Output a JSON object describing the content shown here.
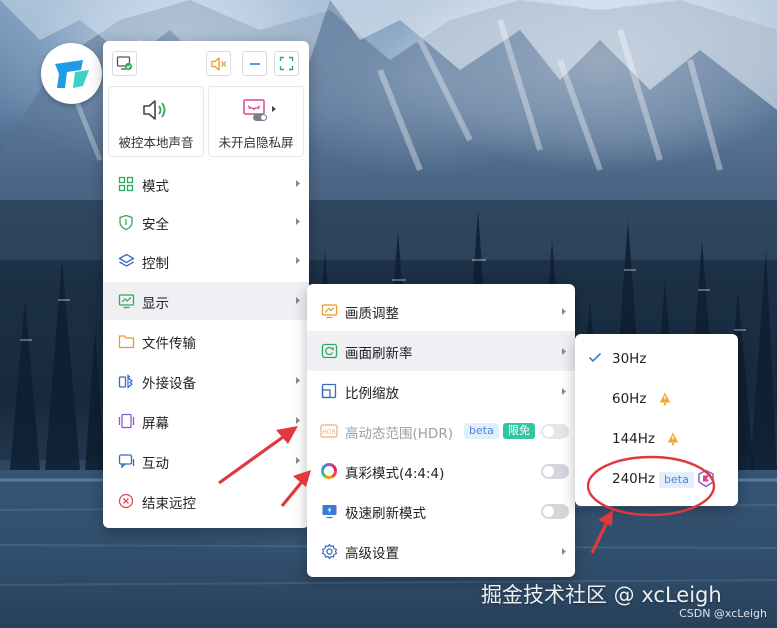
{
  "colors": {
    "accent_green": "#2faa5a",
    "accent_orange": "#e89a2a",
    "warn_orange": "#f3a629",
    "beta_blue": "#4a86d8",
    "free_green": "#33c6a1",
    "close_red": "#e24a4a",
    "check_blue": "#3a7bd5",
    "annotation_red": "#e0383c"
  },
  "toolbar": {
    "icons": [
      "monitor-check-icon",
      "sound-muted-icon",
      "minimize-icon",
      "fullscreen-icon"
    ]
  },
  "cards": {
    "sound": {
      "label": "被控本地声音",
      "icon": "speaker-icon"
    },
    "privacy": {
      "label": "未开启隐私屏",
      "icon": "privacy-screen-icon"
    }
  },
  "menu": {
    "items": [
      {
        "label": "模式",
        "icon": "grid-icon"
      },
      {
        "label": "安全",
        "icon": "shield-icon"
      },
      {
        "label": "控制",
        "icon": "layers-icon"
      },
      {
        "label": "显示",
        "icon": "display-icon"
      },
      {
        "label": "文件传输",
        "icon": "folder-icon"
      },
      {
        "label": "外接设备",
        "icon": "bluetooth-device-icon"
      },
      {
        "label": "屏幕",
        "icon": "screen-icon"
      },
      {
        "label": "互动",
        "icon": "chat-icon"
      },
      {
        "label": "结束远控",
        "icon": "close-circle-icon"
      }
    ]
  },
  "display_menu": {
    "items": [
      {
        "label": "画质调整",
        "icon": "image-quality-icon"
      },
      {
        "label": "画面刷新率",
        "icon": "refresh-icon"
      },
      {
        "label": "比例缩放",
        "icon": "scale-icon"
      },
      {
        "label": "高动态范围(HDR)",
        "icon": "hdr-icon",
        "tag_beta": "beta",
        "tag_free": "限免",
        "enabled": false
      },
      {
        "label": "真彩模式(4:4:4)",
        "icon": "color-wheel-icon",
        "enabled": false
      },
      {
        "label": "极速刷新模式",
        "icon": "monitor-bolt-icon",
        "enabled": false
      },
      {
        "label": "高级设置",
        "icon": "gear-icon"
      }
    ]
  },
  "refresh_menu": {
    "items": [
      {
        "label": "30Hz",
        "checked": true
      },
      {
        "label": "60Hz",
        "badge": "warning-bell-icon"
      },
      {
        "label": "144Hz",
        "badge": "warning-bell-icon"
      },
      {
        "label": "240Hz",
        "tag_beta": "beta",
        "badge": "premium-shield-icon"
      }
    ]
  },
  "watermark": {
    "main": "掘金技术社区 @ xcLeigh",
    "small": "CSDN @xcLeigh"
  }
}
